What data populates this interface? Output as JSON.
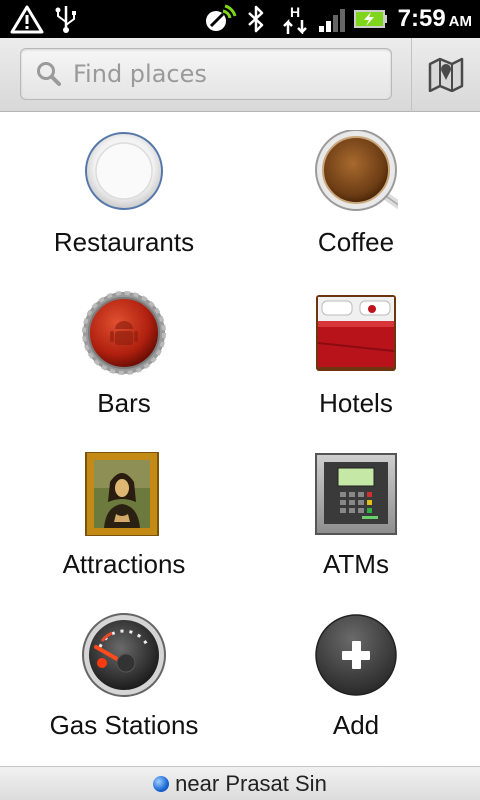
{
  "status_bar": {
    "time": "7:59",
    "ampm": "AM",
    "icons": [
      "warning-icon",
      "usb-icon",
      "gps-icon",
      "bluetooth-icon",
      "hsdpa-data-icon",
      "signal-icon",
      "battery-charging-icon"
    ],
    "accent_color": "#7fd51b"
  },
  "search": {
    "placeholder": "Find places",
    "map_icon": "map-icon"
  },
  "categories": [
    {
      "label": "Restaurants",
      "icon": "restaurant-plate-icon"
    },
    {
      "label": "Coffee",
      "icon": "coffee-cup-icon"
    },
    {
      "label": "Bars",
      "icon": "bottle-cap-icon"
    },
    {
      "label": "Hotels",
      "icon": "hotel-bed-icon"
    },
    {
      "label": "Attractions",
      "icon": "painting-frame-icon"
    },
    {
      "label": "ATMs",
      "icon": "atm-icon"
    },
    {
      "label": "Gas Stations",
      "icon": "fuel-gauge-icon"
    },
    {
      "label": "Add",
      "icon": "add-icon"
    }
  ],
  "location": {
    "text": "near Prasat Sin"
  }
}
